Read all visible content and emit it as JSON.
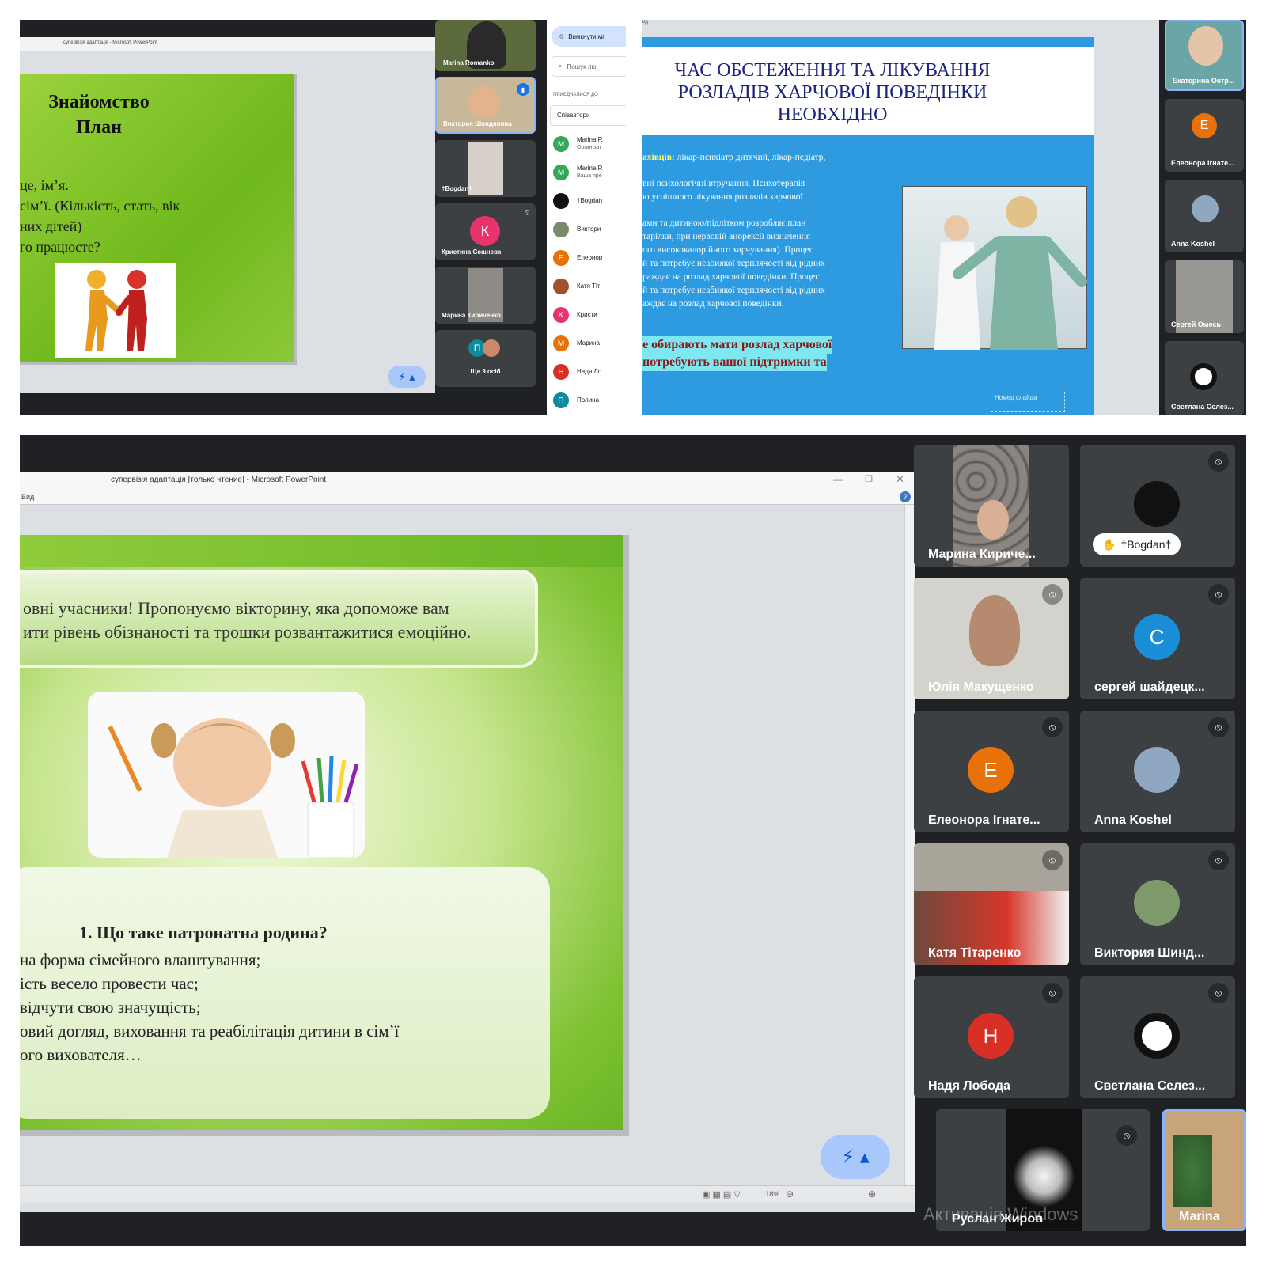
{
  "q1": {
    "window_title": "супервізія адаптація - Microsoft PowerPoint",
    "slide": {
      "title_line1": "Знайомство",
      "title_line2": "План",
      "lines": [
        "це, ім’я.",
        "сім’ї. (Кількість, стать, вік",
        "них дітей)",
        "го працюєте?"
      ]
    },
    "tiles": [
      {
        "name": "Marina Romanko"
      },
      {
        "name": "Виктория Шиндяпина"
      },
      {
        "name": "†Bogdan†"
      },
      {
        "name": "Кристина Сошнева",
        "initial": "К",
        "color": "#e8336d"
      },
      {
        "name": "Марина Кириченко"
      },
      {
        "name": "Ще 9 осіб",
        "initial": "П",
        "color": "#0e8a9c"
      }
    ],
    "panel": {
      "mute_button": "Вимкнути мі",
      "search_placeholder": "Пошук лю",
      "joined_label": "ПРИЄДНАЛИСЯ ДО",
      "coauthors_label": "Співавтори",
      "rows": [
        {
          "initial": "M",
          "color": "#34a853",
          "name": "Marina R",
          "sub": "Організат"
        },
        {
          "initial": "M",
          "color": "#34a853",
          "name": "Marina R",
          "sub": "Ваша пре"
        },
        {
          "initial": "",
          "color": "#111111",
          "name": "†Bogdan",
          "sub": ""
        },
        {
          "initial": "",
          "color": "#7a8a6a",
          "name": "Виктори",
          "sub": ""
        },
        {
          "initial": "E",
          "color": "#e8710a",
          "name": "Елеонор",
          "sub": ""
        },
        {
          "initial": "",
          "color": "#a0522d",
          "name": "Катя Тіт",
          "sub": ""
        },
        {
          "initial": "K",
          "color": "#e8336d",
          "name": "Кристи",
          "sub": ""
        },
        {
          "initial": "M",
          "color": "#e8710a",
          "name": "Марина",
          "sub": ""
        },
        {
          "initial": "H",
          "color": "#d93025",
          "name": "Надя Ло",
          "sub": ""
        },
        {
          "initial": "П",
          "color": "#0e8a9c",
          "name": "Полина",
          "sub": ""
        }
      ]
    }
  },
  "q2": {
    "top_label": "ид",
    "slide": {
      "title_lines": [
        "ЧАС ОБСТЕЖЕННЯ ТА ЛІКУВАННЯ",
        "РОЗЛАДІВ ХАРЧОВОЇ ПОВЕДІНКИ",
        "НЕОБХІДНО"
      ],
      "specialists_label": "ахівців:",
      "specialists_text": "лікар-психіатр дитячий, лікар-педіатр,",
      "para1": [
        "вні психологічні втручання. Психотерапія",
        "ю успішного лікування розладів харчової"
      ],
      "para2": [
        "ами та дитиною/підлітком розробляє план",
        "тарілки, при нервовій анорексії визначення",
        "ого висококалорійного харчування). Процес",
        "й та потребує неабиякої терплячості від рідних",
        "раждає на розлад харчової поведінки. Процес",
        "й та потребує неабиякої терплячості від рідних",
        "аждає на розлад харчової поведінки."
      ],
      "highlight": [
        "е обирають мати розлад харчової",
        "потребують вашої підтримки та"
      ],
      "footer": "Номер слайда"
    },
    "tiles": [
      {
        "name": "Екатерина Остр..."
      },
      {
        "name": "Елеонора Ігнате...",
        "initial": "E",
        "color": "#e8710a"
      },
      {
        "name": "Anna Koshel"
      },
      {
        "name": "Сергей Омесь"
      },
      {
        "name": "Светлана Селез..."
      }
    ]
  },
  "main": {
    "window_title": "супервізія адаптація [только чтение] - Microsoft PowerPoint",
    "menu_item": "Вид",
    "slide": {
      "intro_line1": "овні учасники! Пропонуємо вікторину, яка допоможе вам",
      "intro_line2": "ити рівень обізнаності та трошки розвантажитися емоційно.",
      "question": "1.   Що таке патронатна родина?",
      "answers": [
        "на форма сімейного влаштування;",
        "ість весело провести час;",
        "відчути свою значущість;",
        "овий догляд, виховання та реабілітація дитини в сім’ї",
        "ого вихователя…"
      ]
    },
    "zoom": "118%",
    "watermark": "Активація Windows",
    "tiles": [
      {
        "name": "Марина Кириче...",
        "muted": false
      },
      {
        "name": "†Bogdan†",
        "muted": true
      },
      {
        "name": "Юлія Макущенко",
        "muted": true
      },
      {
        "name": "сергей шайдецк...",
        "initial": "C",
        "color": "#1a8fd8",
        "muted": true
      },
      {
        "name": "Елеонора Ігнате...",
        "initial": "E",
        "color": "#e8710a",
        "muted": true
      },
      {
        "name": "Anna Koshel",
        "muted": true
      },
      {
        "name": "Катя Тітаренко",
        "muted": true
      },
      {
        "name": "Виктория Шинд...",
        "muted": true
      },
      {
        "name": "Надя Лобода",
        "initial": "H",
        "color": "#d93025",
        "muted": true
      },
      {
        "name": "Светлана Селез...",
        "muted": true
      },
      {
        "name": "Руслан Жиров",
        "muted": true
      },
      {
        "name": "Marina",
        "muted": false
      }
    ]
  }
}
